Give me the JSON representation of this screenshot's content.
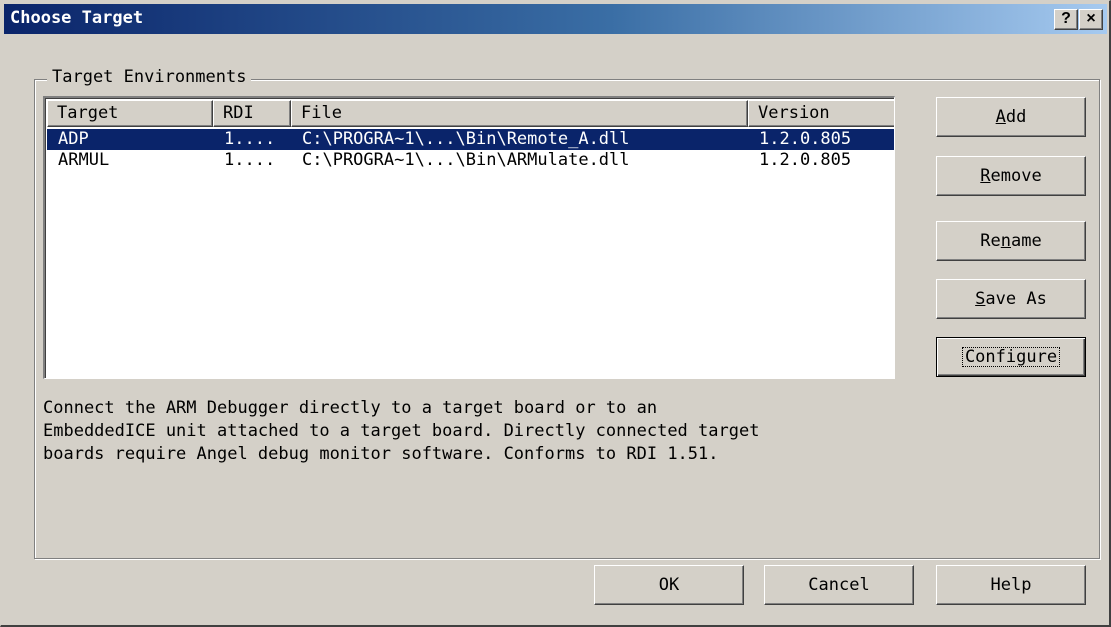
{
  "window": {
    "title": "Choose Target",
    "help_symbol": "?",
    "close_symbol": "×"
  },
  "group": {
    "label": "Target Environments"
  },
  "list": {
    "columns": [
      "Target",
      "RDI",
      "File",
      "Version"
    ],
    "rows": [
      {
        "target": "ADP",
        "rdi": "1....",
        "file": "C:\\PROGRA~1\\...\\Bin\\Remote_A.dll",
        "version": "1.2.0.805",
        "selected": true
      },
      {
        "target": "ARMUL",
        "rdi": "1....",
        "file": "C:\\PROGRA~1\\...\\Bin\\ARMulate.dll",
        "version": "1.2.0.805",
        "selected": false
      }
    ]
  },
  "description": {
    "lines": [
      "Connect the ARM Debugger directly to a target board or to an",
      "EmbeddedICE unit attached to a target board. Directly connected target",
      "boards require Angel debug monitor software. Conforms to RDI 1.51."
    ]
  },
  "side_buttons": {
    "add": {
      "pre": "",
      "key": "A",
      "post": "dd"
    },
    "remove": {
      "pre": "",
      "key": "R",
      "post": "emove"
    },
    "rename": {
      "pre": "Re",
      "key": "n",
      "post": "ame"
    },
    "save_as": {
      "pre": "",
      "key": "S",
      "post": "ave As"
    },
    "configure": "Configure"
  },
  "bottom_buttons": {
    "ok": "OK",
    "cancel": "Cancel",
    "help": "Help"
  },
  "colors": {
    "title_gradient_start": "#0a246a",
    "title_gradient_end": "#a6caf0",
    "selection": "#0a246a",
    "face": "#d4d0c8"
  }
}
